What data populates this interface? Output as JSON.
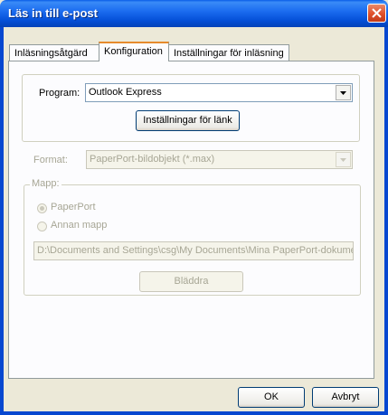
{
  "window": {
    "title": "Läs in till e-post"
  },
  "tabs": [
    {
      "label": "Inläsningsåtgärd"
    },
    {
      "label": "Konfiguration"
    },
    {
      "label": "Inställningar för inläsning"
    }
  ],
  "program": {
    "label": "Program:",
    "value": "Outlook Express"
  },
  "link_settings_button": "Inställningar för länk",
  "format": {
    "label": "Format:",
    "value": "PaperPort-bildobjekt (*.max)"
  },
  "folder": {
    "label": "Mapp:",
    "options": [
      {
        "label": "PaperPort",
        "selected": true
      },
      {
        "label": "Annan mapp",
        "selected": false
      }
    ],
    "path": "D:\\Documents and Settings\\csg\\My Documents\\Mina PaperPort-dokument",
    "browse_label": "Bläddra"
  },
  "buttons": {
    "ok": "OK",
    "cancel": "Avbryt"
  },
  "colors": {
    "titlebar": "#0a5ee8",
    "tab_highlight": "#e68b2c",
    "close": "#e0502a"
  }
}
